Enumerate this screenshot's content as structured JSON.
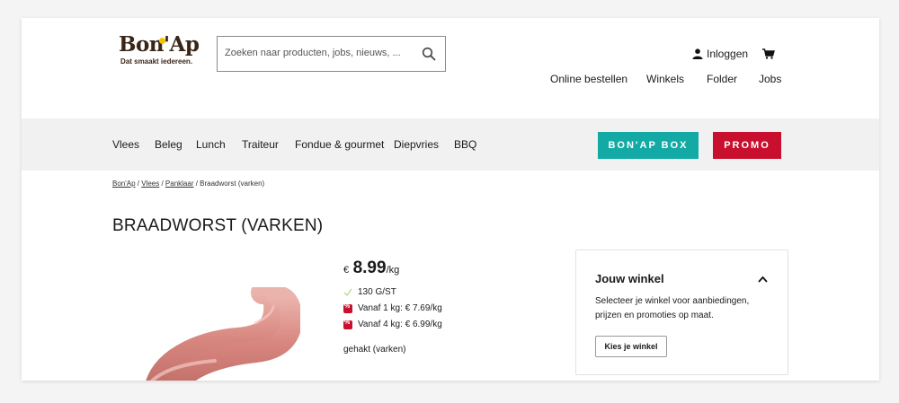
{
  "header": {
    "logo": {
      "wordmark": "Bon'Ap",
      "tagline": "Dat smaakt iedereen."
    },
    "search": {
      "placeholder": "Zoeken naar producten, jobs, nieuws, ..."
    },
    "login_label": "Inloggen",
    "top_links": [
      "Online bestellen",
      "Winkels",
      "Folder",
      "Jobs"
    ]
  },
  "navbar": {
    "categories": [
      "Vlees",
      "Beleg",
      "Lunch",
      "Traiteur",
      "Fondue & gourmet",
      "Diepvries",
      "BBQ"
    ],
    "box_button": "BON'AP BOX",
    "promo_button": "PROMO",
    "colors": {
      "box": "#13aaa5",
      "promo": "#c8102e"
    }
  },
  "breadcrumb": {
    "items": [
      "Bon'Ap",
      "Vlees",
      "Panklaar"
    ],
    "current": "Braadworst (varken)",
    "separator": " / "
  },
  "product": {
    "title": "BRAADWORST (VARKEN)",
    "price": {
      "currency": "€",
      "amount": "8.99",
      "unit": "/kg"
    },
    "weight": "130 G/ST",
    "offers": [
      "Vanaf 1 kg: € 7.69/kg",
      "Vanaf 4 kg: € 6.99/kg"
    ],
    "description": "gehakt (varken)"
  },
  "store_card": {
    "title": "Jouw winkel",
    "description": "Selecteer je winkel voor aanbiedingen, prijzen en promoties op maat.",
    "button": "Kies je winkel"
  }
}
